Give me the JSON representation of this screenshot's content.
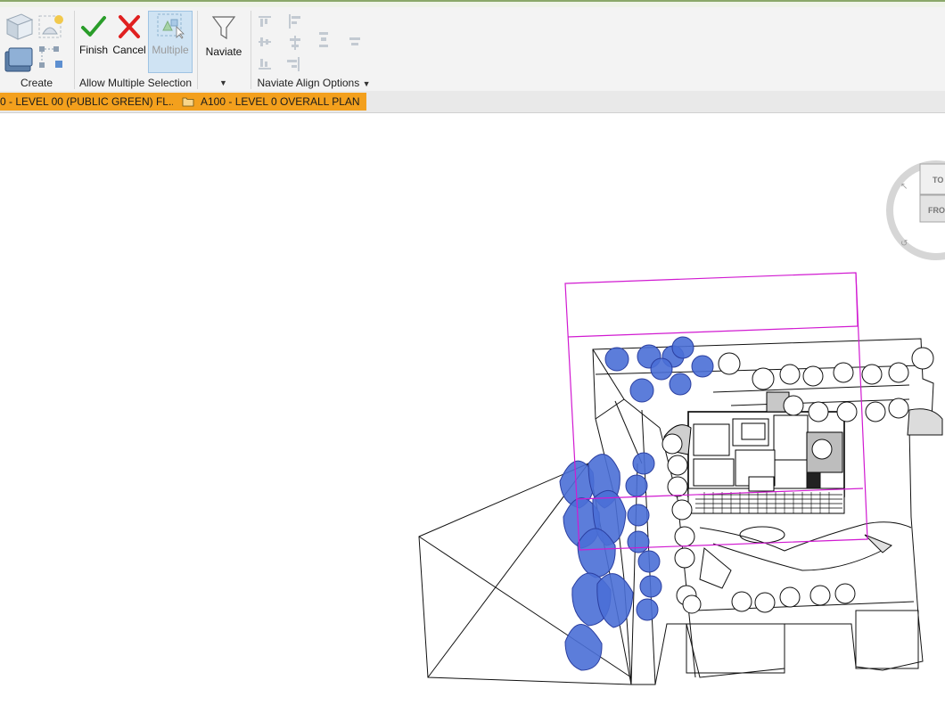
{
  "ribbon": {
    "panels": {
      "create": {
        "label": "Create"
      },
      "selection": {
        "label": "Allow Multiple Selection",
        "finish_label": "Finish",
        "cancel_label": "Cancel",
        "multiple_label": "Multiple"
      },
      "naviate": {
        "label": "Naviate"
      },
      "align": {
        "label": "Naviate Align Options"
      }
    }
  },
  "tabs": [
    {
      "label": "0 - LEVEL 00 (PUBLIC GREEN) FL..."
    },
    {
      "label": "A100 - LEVEL 0 OVERALL PLAN"
    }
  ],
  "viewcube": {
    "top_label": "TO",
    "front_label": "FRO"
  },
  "colors": {
    "tab_active": "#f3a01d",
    "selection_box": "#d11ad1",
    "tree_fill": "#4a6fd6",
    "finish_check": "#2a9d2a",
    "cancel_x": "#e02020"
  }
}
